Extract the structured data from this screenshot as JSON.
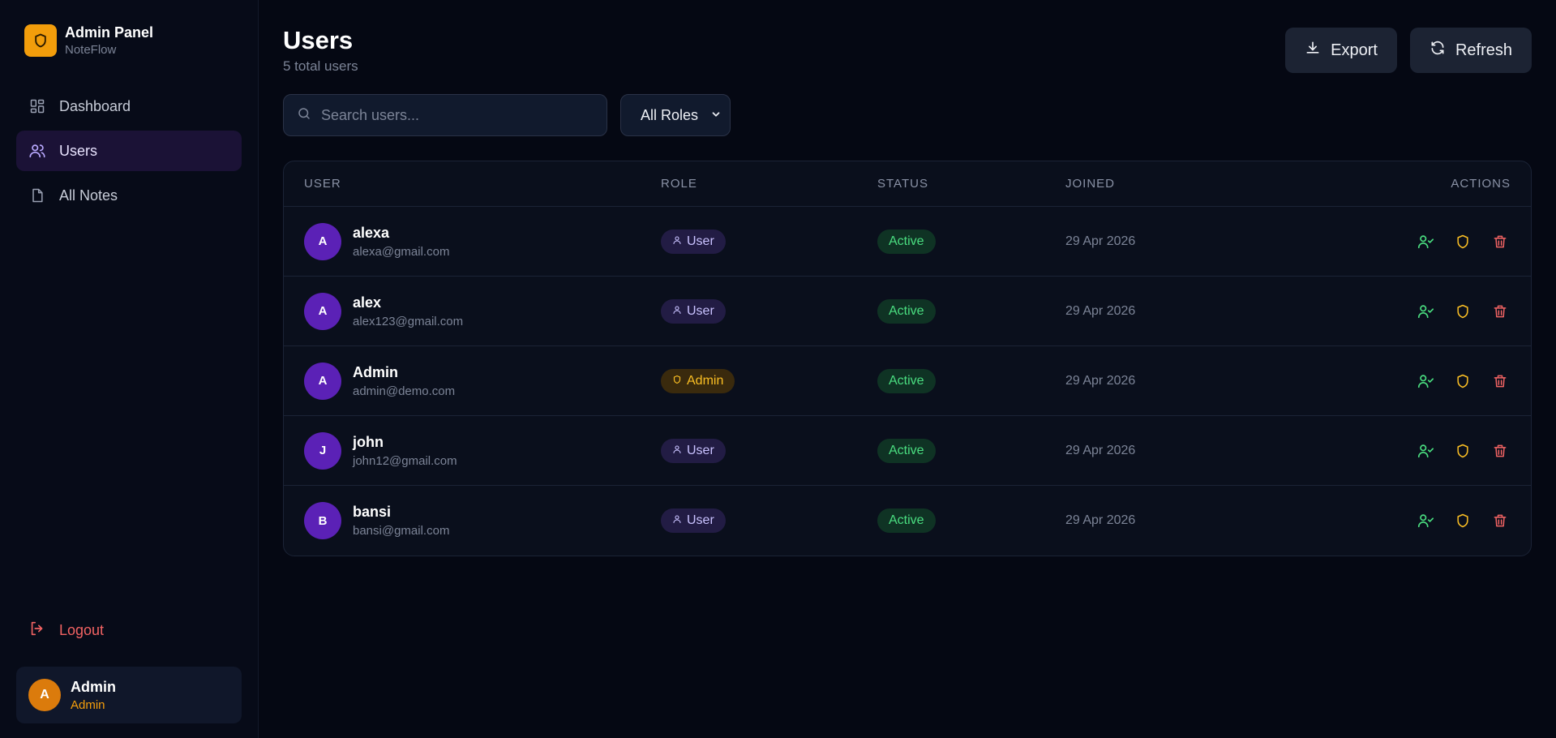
{
  "brand": {
    "title": "Admin Panel",
    "subtitle": "NoteFlow",
    "icon": "shield-icon",
    "accent": "#f29d0b"
  },
  "sidebar": {
    "items": [
      {
        "label": "Dashboard",
        "icon": "dashboard-icon",
        "active": false
      },
      {
        "label": "Users",
        "icon": "users-icon",
        "active": true
      },
      {
        "label": "All Notes",
        "icon": "file-icon",
        "active": false
      }
    ],
    "logout_label": "Logout",
    "current_user": {
      "initial": "A",
      "name": "Admin",
      "role": "Admin"
    }
  },
  "header": {
    "title": "Users",
    "subtitle": "5 total users",
    "export_label": "Export",
    "refresh_label": "Refresh"
  },
  "filters": {
    "search_placeholder": "Search users...",
    "role_selected": "All Roles"
  },
  "table": {
    "columns": [
      "USER",
      "ROLE",
      "STATUS",
      "JOINED",
      "ACTIONS"
    ],
    "rows": [
      {
        "initial": "A",
        "name": "alexa",
        "email": "alexa@gmail.com",
        "role": "User",
        "status": "Active",
        "joined": "29 Apr 2026"
      },
      {
        "initial": "A",
        "name": "alex",
        "email": "alex123@gmail.com",
        "role": "User",
        "status": "Active",
        "joined": "29 Apr 2026"
      },
      {
        "initial": "A",
        "name": "Admin",
        "email": "admin@demo.com",
        "role": "Admin",
        "status": "Active",
        "joined": "29 Apr 2026"
      },
      {
        "initial": "J",
        "name": "john",
        "email": "john12@gmail.com",
        "role": "User",
        "status": "Active",
        "joined": "29 Apr 2026"
      },
      {
        "initial": "B",
        "name": "bansi",
        "email": "bansi@gmail.com",
        "role": "User",
        "status": "Active",
        "joined": "29 Apr 2026"
      }
    ]
  },
  "colors": {
    "status_active": "#4ade80",
    "danger": "#f26363",
    "warning": "#fbbf24",
    "purple": "#5b21b6"
  }
}
